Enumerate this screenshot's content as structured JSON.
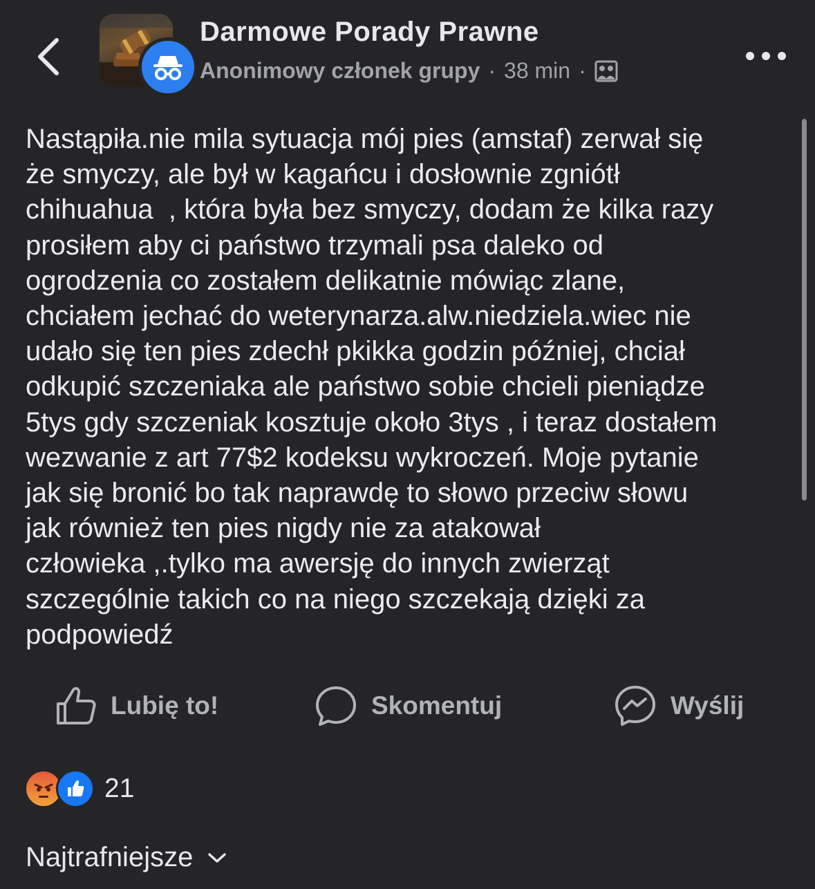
{
  "header": {
    "back_icon": "chevron-left-icon",
    "group_name": "Darmowe Porady Prawne",
    "author": "Anonimowy członek grupy",
    "separator": "·",
    "time": "38 min",
    "audience_icon": "group-icon",
    "more_icon": "more-horizontal-icon"
  },
  "post": {
    "text": "Nastąpiła.nie mila sytuacja mój pies (amstaf) zerwał się\nże smyczy, ale był w kagańcu i dosłownie zgniótł\nchihuahua  , która była bez smyczy, dodam że kilka razy\nprosiłem aby ci państwo trzymali psa daleko od\nogrodzenia co zostałem delikatnie mówiąc zlane,\nchciałem jechać do weterynarza.alw.niedziela.wiec nie\nudało się ten pies zdechł pkikka godzin później, chciał\nodkupić szczeniaka ale państwo sobie chcieli pieniądze\n5tys gdy szczeniak kosztuje około 3tys , i teraz dostałem\nwezwanie z art 77$2 kodeksu wykroczeń. Moje pytanie\njak się bronić bo tak naprawdę to słowo przeciw słowu\njak również ten pies nigdy nie za atakował\nczłowieka ,.tylko ma awersję do innych zwierząt\nszczególnie takich co na niego szczekają dzięki za\npodpowiedź"
  },
  "actions": {
    "like": "Lubię to!",
    "comment": "Skomentuj",
    "share": "Wyślij"
  },
  "reactions": {
    "types": [
      "angry",
      "like"
    ],
    "count": "21"
  },
  "comments": {
    "sort_label": "Najtrafniejsze"
  },
  "colors": {
    "background": "#252527",
    "text": "#e4e6eb",
    "secondary_text": "#a0a3a8",
    "badge_blue": "#2c7ff0",
    "like_blue": "#1877f2"
  }
}
